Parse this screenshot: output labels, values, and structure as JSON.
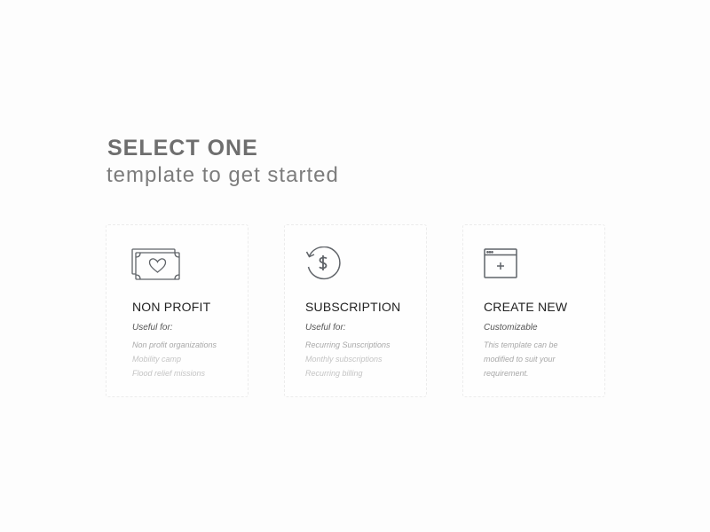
{
  "heading": {
    "primary": "SELECT ONE",
    "secondary": "template to get started"
  },
  "cards": [
    {
      "icon": "money-heart-icon",
      "title": "NON PROFIT",
      "label": "Useful for:",
      "items": [
        "Non profit organizations",
        "Mobility camp",
        "Flood relief missions"
      ]
    },
    {
      "icon": "recurring-dollar-icon",
      "title": "SUBSCRIPTION",
      "label": "Useful for:",
      "items": [
        "Recurring Sunscriptions",
        "Monthly subscriptions",
        "Recurring billing"
      ]
    },
    {
      "icon": "new-window-icon",
      "title": "CREATE NEW",
      "label": "Customizable",
      "items": [
        "This template can be",
        "modified to suit your",
        "requirement."
      ]
    }
  ],
  "colors": {
    "icon_stroke": "#5f6368",
    "heading": "#6e6e6e",
    "title": "#222222",
    "muted": "#a8a8a8"
  }
}
